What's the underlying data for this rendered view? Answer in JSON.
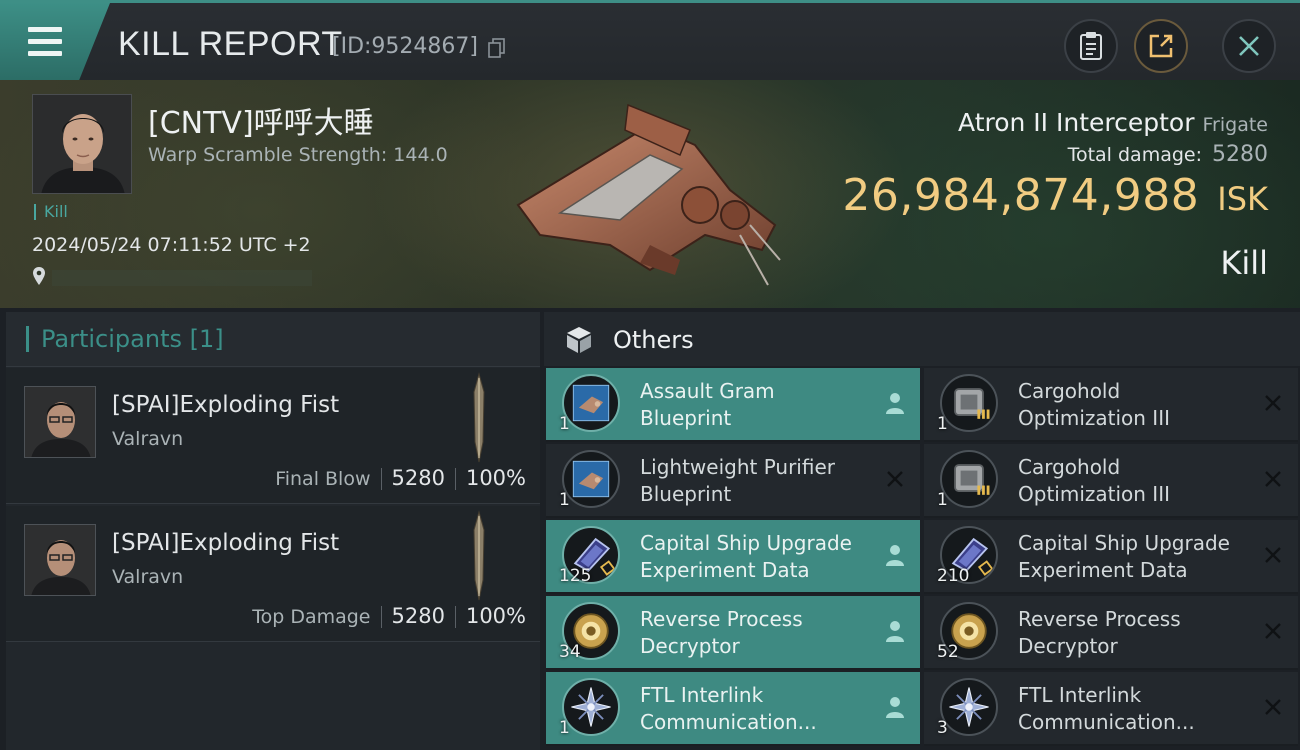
{
  "header": {
    "title": "KILL REPORT",
    "report_id": "[ID:9524867]"
  },
  "victim": {
    "name": "[CNTV]呼呼大睡",
    "warp_label": "Warp Scramble Strength:",
    "warp_value": "144.0",
    "kill_tag": "Kill",
    "timestamp": "2024/05/24 07:11:52 UTC +2",
    "ship_name": "Atron II Interceptor",
    "ship_class": "Frigate",
    "damage_label": "Total damage:",
    "damage_value": "5280",
    "isk_value": "26,984,874,988",
    "isk_unit": "ISK",
    "result": "Kill"
  },
  "participants": {
    "title": "Participants [1]",
    "rows": [
      {
        "name": "[SPAI]Exploding Fist",
        "ship": "Valravn",
        "role": "Final Blow",
        "damage": "5280",
        "percent": "100%"
      },
      {
        "name": "[SPAI]Exploding Fist",
        "ship": "Valravn",
        "role": "Top Damage",
        "damage": "5280",
        "percent": "100%"
      }
    ]
  },
  "others": {
    "title": "Others",
    "items": [
      {
        "line1": "Assault Gram",
        "line2": "Blueprint",
        "qty": "1",
        "highlighted": true,
        "action": "person-icon",
        "icon": "blueprint-icon"
      },
      {
        "line1": "Cargohold",
        "line2": "Optimization III",
        "qty": "1",
        "highlighted": false,
        "action": "close-icon",
        "icon": "cargohold-rig-icon"
      },
      {
        "line1": "Lightweight Purifier",
        "line2": "Blueprint",
        "qty": "1",
        "highlighted": false,
        "action": "close-icon",
        "icon": "blueprint-icon"
      },
      {
        "line1": "Cargohold",
        "line2": "Optimization III",
        "qty": "1",
        "highlighted": false,
        "action": "close-icon",
        "icon": "cargohold-rig-icon"
      },
      {
        "line1": "Capital Ship Upgrade",
        "line2": "Experiment Data",
        "qty": "125",
        "highlighted": true,
        "action": "person-icon",
        "icon": "data-chip-icon"
      },
      {
        "line1": "Capital Ship Upgrade",
        "line2": "Experiment Data",
        "qty": "210",
        "highlighted": false,
        "action": "close-icon",
        "icon": "data-chip-icon"
      },
      {
        "line1": "Reverse Process",
        "line2": "Decryptor",
        "qty": "34",
        "highlighted": true,
        "action": "person-icon",
        "icon": "decryptor-icon"
      },
      {
        "line1": "Reverse Process",
        "line2": "Decryptor",
        "qty": "52",
        "highlighted": false,
        "action": "close-icon",
        "icon": "decryptor-icon"
      },
      {
        "line1": "FTL Interlink",
        "line2": "Communication...",
        "qty": "1",
        "highlighted": true,
        "action": "person-icon",
        "icon": "ftl-interlink-icon"
      },
      {
        "line1": "FTL Interlink",
        "line2": "Communication...",
        "qty": "3",
        "highlighted": false,
        "action": "close-icon",
        "icon": "ftl-interlink-icon"
      }
    ]
  },
  "colors": {
    "accent_teal": "#3e8a82",
    "isk_gold": "#f1cc82",
    "panel_dark": "#1c2025"
  }
}
